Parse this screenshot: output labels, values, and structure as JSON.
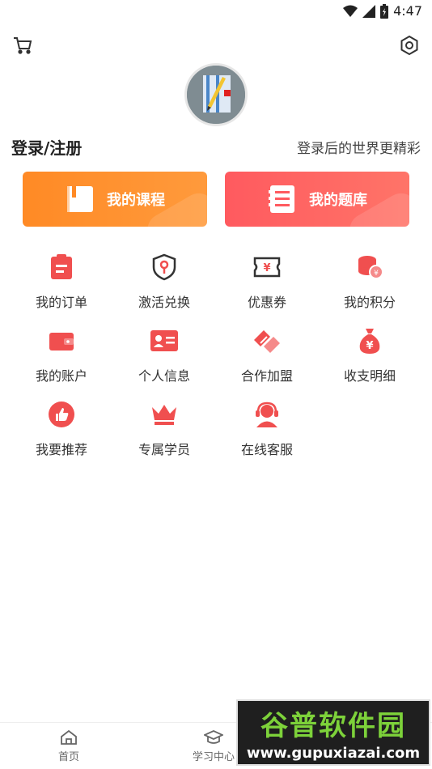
{
  "status_bar": {
    "time": "4:47"
  },
  "header": {
    "cart_icon": "cart-icon",
    "settings_icon": "gear-icon"
  },
  "profile": {
    "login_label": "登录/注册",
    "hint": "登录后的世界更精彩"
  },
  "big_buttons": [
    {
      "label": "我的课程",
      "icon": "book-icon",
      "color": "#ff8a25"
    },
    {
      "label": "我的题库",
      "icon": "question-bank-icon",
      "color": "#ff5a5f"
    }
  ],
  "grid": [
    {
      "label": "我的订单",
      "icon": "order-icon"
    },
    {
      "label": "激活兑换",
      "icon": "activate-icon"
    },
    {
      "label": "优惠券",
      "icon": "coupon-icon"
    },
    {
      "label": "我的积分",
      "icon": "points-icon"
    },
    {
      "label": "我的账户",
      "icon": "wallet-icon"
    },
    {
      "label": "个人信息",
      "icon": "id-card-icon"
    },
    {
      "label": "合作加盟",
      "icon": "handshake-icon"
    },
    {
      "label": "收支明细",
      "icon": "money-bag-icon"
    },
    {
      "label": "我要推荐",
      "icon": "thumbs-up-icon"
    },
    {
      "label": "专属学员",
      "icon": "crown-icon"
    },
    {
      "label": "在线客服",
      "icon": "support-icon"
    }
  ],
  "bottom_nav": [
    {
      "label": "首页",
      "icon": "home-icon"
    },
    {
      "label": "学习中心",
      "icon": "graduation-icon"
    }
  ],
  "accent_color": "#f04f4f",
  "watermark": {
    "title": "谷普软件园",
    "url": "www.gupuxiazai.com"
  }
}
